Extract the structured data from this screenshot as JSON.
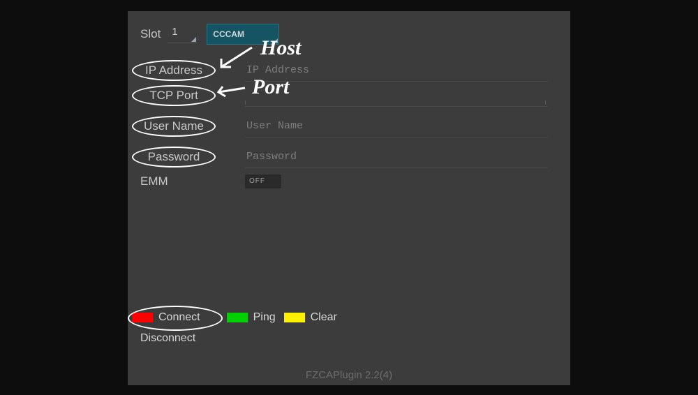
{
  "header": {
    "slot_label": "Slot",
    "slot_value": "1",
    "protocol": "CCCAM"
  },
  "fields": {
    "ip": {
      "label": "IP Address",
      "placeholder": "IP Address",
      "value": ""
    },
    "port": {
      "label": "TCP Port",
      "placeholder": "",
      "value": ""
    },
    "user": {
      "label": "User Name",
      "placeholder": "User Name",
      "value": ""
    },
    "pass": {
      "label": "Password",
      "placeholder": "Password",
      "value": ""
    },
    "emm": {
      "label": "EMM",
      "state": "OFF"
    }
  },
  "annotations": {
    "host": "Host",
    "port": "Port"
  },
  "actions": {
    "connect": "Connect",
    "ping": "Ping",
    "clear": "Clear",
    "disconnect": "Disconnect"
  },
  "footer": "FZCAPlugin 2.2(4)"
}
